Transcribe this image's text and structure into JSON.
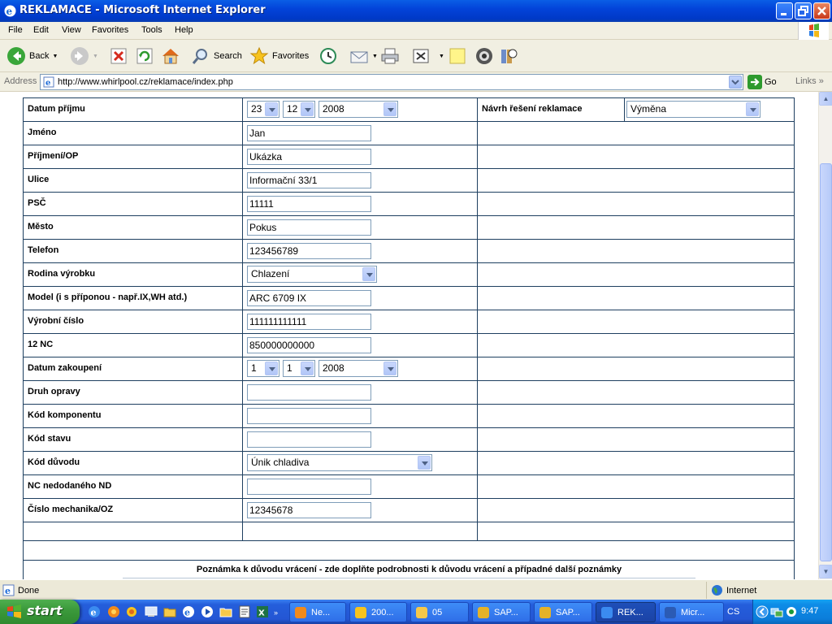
{
  "window": {
    "title": "REKLAMACE - Microsoft Internet Explorer"
  },
  "menu": [
    "File",
    "Edit",
    "View",
    "Favorites",
    "Tools",
    "Help"
  ],
  "toolbar": {
    "back_label": "Back",
    "search_label": "Search",
    "favorites_label": "Favorites"
  },
  "address": {
    "label": "Address",
    "url": "http://www.whirlpool.cz/reklamace/index.php",
    "go_label": "Go",
    "links_label": "Links"
  },
  "form": {
    "rows": [
      {
        "label": "Datum příjmu",
        "type": "date",
        "day": "23",
        "month": "12",
        "year": "2008"
      },
      {
        "label": "Jméno",
        "type": "text",
        "value": "Jan"
      },
      {
        "label": "Příjmení/OP",
        "type": "text",
        "value": "Ukázka"
      },
      {
        "label": "Ulice",
        "type": "text",
        "value": "Informační 33/1"
      },
      {
        "label": "PSČ",
        "type": "text",
        "value": "11111"
      },
      {
        "label": "Město",
        "type": "text",
        "value": "Pokus"
      },
      {
        "label": "Telefon",
        "type": "text",
        "value": "123456789"
      },
      {
        "label": "Rodina výrobku",
        "type": "select",
        "value": "Chlazení"
      },
      {
        "label": "Model (i s příponou - např.IX,WH atd.)",
        "type": "text",
        "value": "ARC 6709 IX"
      },
      {
        "label": "Výrobní číslo",
        "type": "text",
        "value": "111111111111"
      },
      {
        "label": "12 NC",
        "type": "text",
        "value": "850000000000"
      },
      {
        "label": "Datum zakoupení",
        "type": "date",
        "day": "1",
        "month": "1",
        "year": "2008"
      },
      {
        "label": "Druh opravy",
        "type": "text",
        "value": ""
      },
      {
        "label": "Kód komponentu",
        "type": "text",
        "value": ""
      },
      {
        "label": "Kód stavu",
        "type": "text",
        "value": ""
      },
      {
        "label": "Kód důvodu",
        "type": "select",
        "value": "Únik chladiva"
      },
      {
        "label": "NC nedodaného ND",
        "type": "text",
        "value": ""
      },
      {
        "label": "Číslo mechanika/OZ",
        "type": "text",
        "value": "12345678"
      }
    ],
    "resolution_label": "Návrh řešení  reklamace",
    "resolution_value": "Výměna",
    "note_label": "Poznámka k důvodu vrácení - zde doplňte podrobnosti k důvodu vrácení a případné další poznámky"
  },
  "status": {
    "text": "Done",
    "zone": "Internet"
  },
  "taskbar": {
    "start_label": "start",
    "tasks": [
      {
        "label": "Ne...",
        "icon": "browser-icon"
      },
      {
        "label": "200...",
        "icon": "app-icon"
      },
      {
        "label": "05",
        "icon": "folder-icon"
      },
      {
        "label": "SAP...",
        "icon": "sap-icon"
      },
      {
        "label": "SAP...",
        "icon": "sap-icon"
      },
      {
        "label": "REK...",
        "icon": "ie-icon",
        "active": true
      },
      {
        "label": "Micr...",
        "icon": "word-icon"
      }
    ],
    "language": "CS",
    "clock": "9:47"
  }
}
